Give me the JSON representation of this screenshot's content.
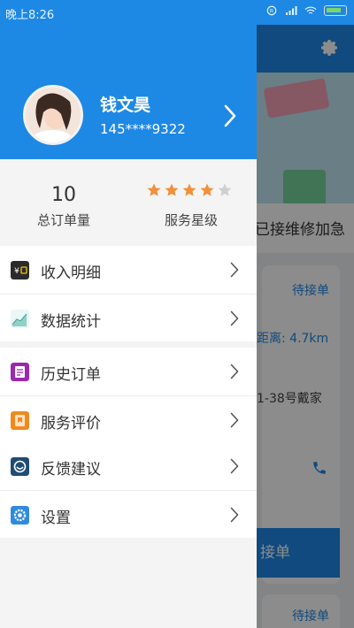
{
  "status_bar": {
    "time": "晚上8:26"
  },
  "background_app": {
    "strip_text": "已接维修加急",
    "card_status": "待接单",
    "card_distance": "距离: 4.7km",
    "card_address": "1-38号戴家",
    "accept_button": "接单",
    "card2_status": "待接单",
    "gear_icon": "gear-icon",
    "phone_icon": "phone-icon"
  },
  "drawer": {
    "profile": {
      "name": "钱文昊",
      "phone": "145****9322",
      "avatar_icon": "avatar-photo",
      "chevron_icon": "chevron-right-icon"
    },
    "stats": {
      "order_count": "10",
      "order_count_label": "总订单量",
      "star_rating": 4,
      "star_max": 5,
      "star_label": "服务星级"
    },
    "menu_groups": [
      {
        "items": [
          {
            "label": "收入明细",
            "icon": "wallet-icon",
            "icon_color": "#2b2b2b"
          },
          {
            "label": "数据统计",
            "icon": "chart-icon",
            "icon_color": "#6dc2c6"
          }
        ]
      },
      {
        "items": [
          {
            "label": "历史订单",
            "icon": "history-icon",
            "icon_color": "#9c27b0"
          },
          {
            "label": "服务评价",
            "icon": "review-icon",
            "icon_color": "#f08a1d"
          }
        ]
      },
      {
        "items": [
          {
            "label": "反馈建议",
            "icon": "feedback-icon",
            "icon_color": "#1f4c72"
          },
          {
            "label": "设置",
            "icon": "settings-icon",
            "icon_color": "#2f8be0"
          }
        ]
      }
    ]
  },
  "colors": {
    "primary": "#1e88e5",
    "star_filled": "#f0913a",
    "star_empty": "#cfcfcf"
  }
}
